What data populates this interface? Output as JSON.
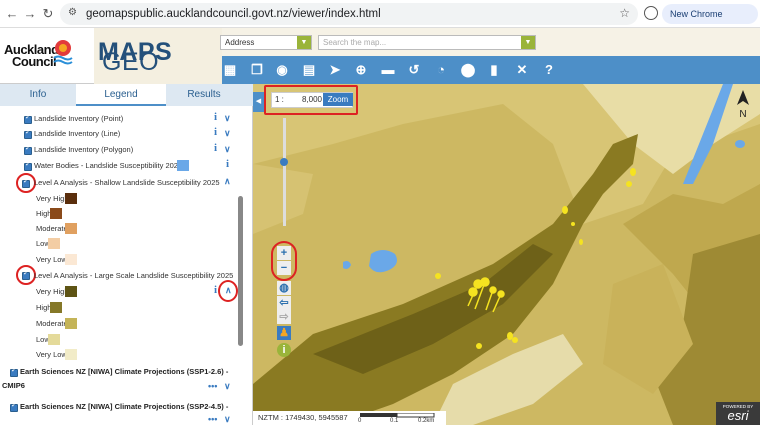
{
  "browser": {
    "url": "geomapspublic.aucklandcouncil.govt.nz/viewer/index.html",
    "update_label": "New Chrome available"
  },
  "header": {
    "logo_line1": "Auckland",
    "logo_line2": "Council",
    "app_title_pre": "GEO",
    "app_title_post": "MAPS",
    "address_select": "Address",
    "search_placeholder": "Search the map..."
  },
  "tabs": [
    "Info",
    "Legend",
    "Results"
  ],
  "legend": {
    "layers": [
      {
        "label": "Landslide Inventory (Point)"
      },
      {
        "label": "Landslide Inventory (Line)"
      },
      {
        "label": "Landslide Inventory (Polygon)"
      },
      {
        "label": "Water Bodies - Landslide Susceptibility 2025"
      },
      {
        "label": "Level A Analysis - Shallow Landslide Susceptibility 2025"
      },
      {
        "label": "Level A Analysis - Large Scale Landslide Susceptibility 2025"
      }
    ],
    "shallow_classes": [
      {
        "label": "Very High",
        "color": "#5a2e0c"
      },
      {
        "label": "High",
        "color": "#8a4a1a"
      },
      {
        "label": "Moderate",
        "color": "#e0a060"
      },
      {
        "label": "Low",
        "color": "#f3cda4"
      },
      {
        "label": "Very Low",
        "color": "#fbe8d4"
      }
    ],
    "large_classes": [
      {
        "label": "Very High",
        "color": "#5e5414"
      },
      {
        "label": "High",
        "color": "#857828"
      },
      {
        "label": "Moderate",
        "color": "#c4b458"
      },
      {
        "label": "Low",
        "color": "#e4da9a"
      },
      {
        "label": "Very Low",
        "color": "#f2ecc8"
      }
    ],
    "groups": [
      {
        "label_line1": "Earth Sciences NZ [NIWA] Climate Projections (SSP1-2.6) -",
        "label_line2": "CMIP6"
      },
      {
        "label_line1": "Earth Sciences NZ [NIWA] Climate Projections (SSP2-4.5) -",
        "label_line2": ""
      }
    ],
    "water_color": "#6aa8e8"
  },
  "map": {
    "scale_prefix": "1 :",
    "scale_value": "8,000",
    "zoom_label": "Zoom",
    "north_label": "N",
    "coords": "NZTM : 1749430, 5945587",
    "scale_ticks": [
      "0",
      "0.1",
      "0.2km"
    ],
    "esri_small": "POWERED BY",
    "esri_label": "esri"
  }
}
